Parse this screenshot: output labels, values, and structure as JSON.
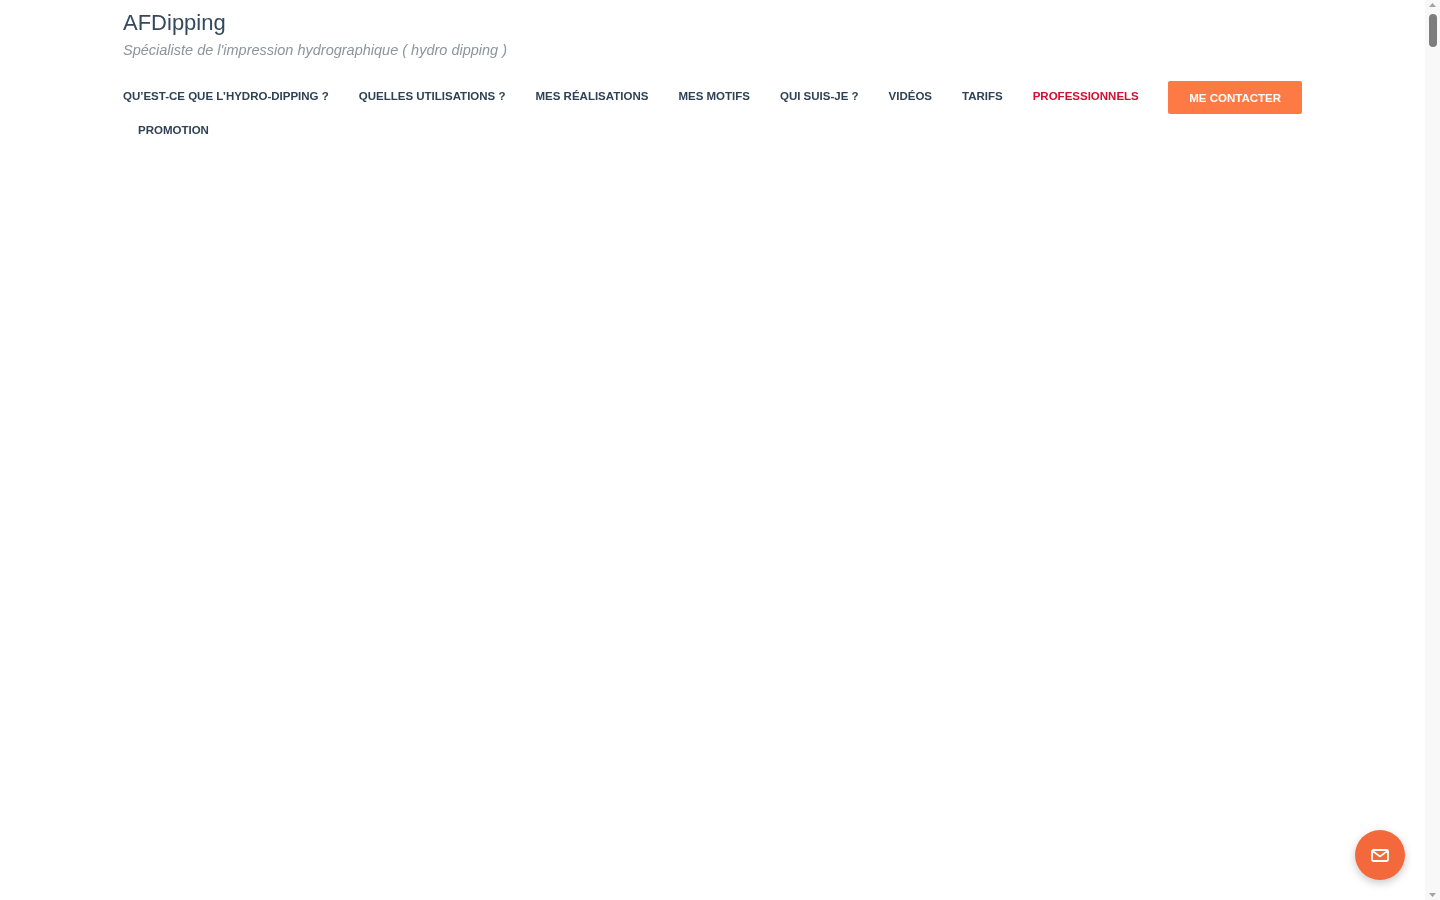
{
  "site": {
    "title": "AFDipping",
    "tagline": "Spécialiste de l'impression hydrographique ( hydro dipping )"
  },
  "nav": {
    "items": [
      {
        "label": "QU’EST-CE QUE L’HYDRO-DIPPING ?",
        "selected": false
      },
      {
        "label": "QUELLES UTILISATIONS ?",
        "selected": false
      },
      {
        "label": "MES RÉALISATIONS",
        "selected": false
      },
      {
        "label": "MES MOTIFS",
        "selected": false
      },
      {
        "label": "QUI SUIS-JE ?",
        "selected": false
      },
      {
        "label": "VIDÉOS",
        "selected": false
      },
      {
        "label": "TARIFS",
        "selected": false
      },
      {
        "label": "PROFESSIONNELS",
        "selected": true
      },
      {
        "label": "PROMOTION",
        "selected": false
      }
    ],
    "cta": "ME CONTACTER"
  }
}
